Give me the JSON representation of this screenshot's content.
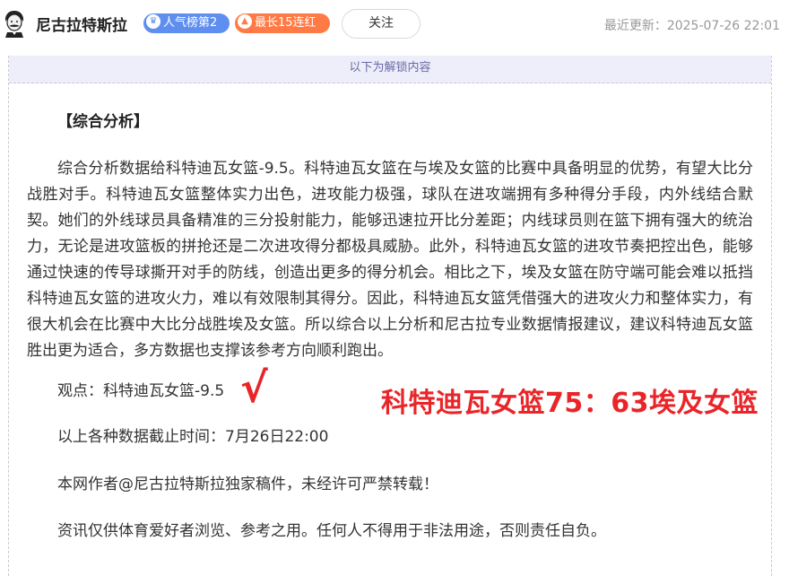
{
  "header": {
    "author_name": "尼古拉特斯拉",
    "badge_rank": "人气榜第2",
    "badge_streak": "最长15连红",
    "follow_label": "关注",
    "updated": "最近更新：2025-07-26 22:01"
  },
  "unlock_notice": "以下为解锁内容",
  "article": {
    "section_title": "【综合分析】",
    "analysis": "综合分析数据给科特迪瓦女篮-9.5。科特迪瓦女篮在与埃及女篮的比赛中具备明显的优势，有望大比分战胜对手。科特迪瓦女篮整体实力出色，进攻能力极强，球队在进攻端拥有多种得分手段，内外线结合默契。她们的外线球员具备精准的三分投射能力，能够迅速拉开比分差距；内线球员则在篮下拥有强大的统治力，无论是进攻篮板的拼抢还是二次进攻得分都极具威胁。此外，科特迪瓦女篮的进攻节奏把控出色，能够通过快速的传导球撕开对手的防线，创造出更多的得分机会。相比之下，埃及女篮在防守端可能会难以抵挡科特迪瓦女篮的进攻火力，难以有效限制其得分。因此，科特迪瓦女篮凭借强大的进攻火力和整体实力，有很大机会在比赛中大比分战胜埃及女篮。所以综合以上分析和尼古拉专业数据情报建议，建议科特迪瓦女篮胜出更为适合，多方数据也支撑该参考方向顺利跑出。",
    "viewpoint": "观点：科特迪瓦女篮-9.5",
    "checkmark": "√",
    "score": "科特迪瓦女篮75：63埃及女篮",
    "cutoff": "以上各种数据截止时间：7月26日22:00",
    "copyright": "本网作者@尼古拉特斯拉独家稿件，未经许可严禁转载！",
    "disclaimer": "资讯仅供体育爱好者浏览、参考之用。任何人不得用于非法用途，否则责任自负。"
  }
}
